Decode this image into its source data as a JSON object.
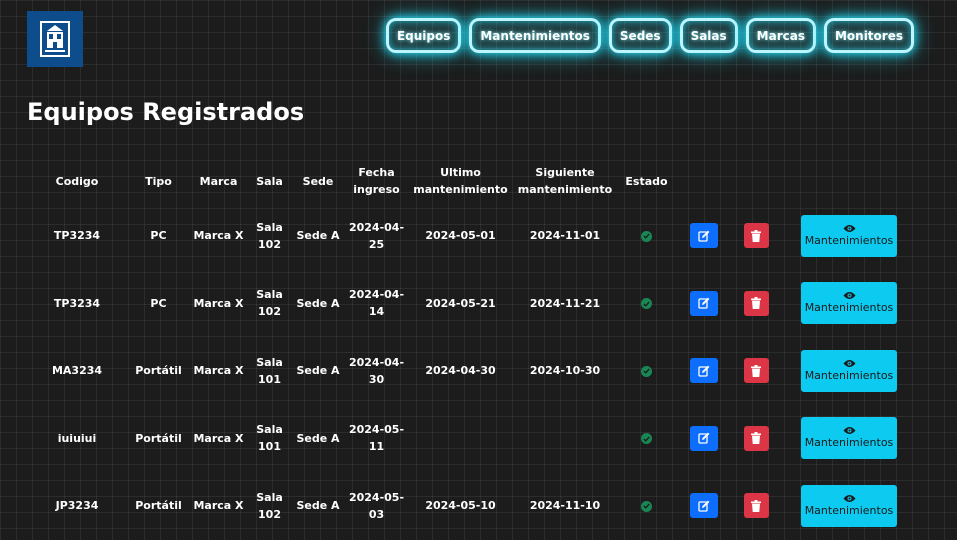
{
  "page": {
    "title": "Equipos Registrados"
  },
  "logo": {
    "icon": "building-icon",
    "color": "#0e4d8c"
  },
  "nav": {
    "items": [
      {
        "label": "Equipos"
      },
      {
        "label": "Mantenimientos"
      },
      {
        "label": "Sedes"
      },
      {
        "label": "Salas"
      },
      {
        "label": "Marcas"
      },
      {
        "label": "Monitores"
      }
    ]
  },
  "table": {
    "headers": {
      "codigo": "Codigo",
      "tipo": "Tipo",
      "marca": "Marca",
      "sala": "Sala",
      "sede": "Sede",
      "fecha": "Fecha ingreso",
      "ultimo": "Ultimo mantenimiento",
      "siguiente": "Siguiente mantenimiento",
      "estado": "Estado"
    },
    "rows": [
      {
        "codigo": "TP3234",
        "tipo": "PC",
        "marca": "Marca X",
        "sala": "Sala 102",
        "sede": "Sede A",
        "fecha": "2024-04-25",
        "ultimo": "2024-05-01",
        "siguiente": "2024-11-01",
        "mant_label": "Mantenimientos"
      },
      {
        "codigo": "TP3234",
        "tipo": "PC",
        "marca": "Marca X",
        "sala": "Sala 102",
        "sede": "Sede A",
        "fecha": "2024-04-14",
        "ultimo": "2024-05-21",
        "siguiente": "2024-11-21",
        "mant_label": "Mantenimientos"
      },
      {
        "codigo": "MA3234",
        "tipo": "Portátil",
        "marca": "Marca X",
        "sala": "Sala 101",
        "sede": "Sede A",
        "fecha": "2024-04-30",
        "ultimo": "2024-04-30",
        "siguiente": "2024-10-30",
        "mant_label": "Mantenimientos"
      },
      {
        "codigo": "iuiuiui",
        "tipo": "Portátil",
        "marca": "Marca X",
        "sala": "Sala 101",
        "sede": "Sede A",
        "fecha": "2024-05-11",
        "ultimo": "",
        "siguiente": "",
        "mant_label": "Mantenimientos"
      },
      {
        "codigo": "JP3234",
        "tipo": "Portátil",
        "marca": "Marca X",
        "sala": "Sala 102",
        "sede": "Sede A",
        "fecha": "2024-05-03",
        "ultimo": "2024-05-10",
        "siguiente": "2024-11-10",
        "mant_label": "Mantenimientos"
      }
    ]
  },
  "colors": {
    "edit": "#0d6efd",
    "delete": "#dc3545",
    "info": "#0dcaf0",
    "status_ok": "#198754",
    "neon": "#22e4ff"
  },
  "icons": {
    "status": "check-circle-icon",
    "edit": "edit-icon",
    "delete": "trash-icon",
    "view": "eye-icon"
  }
}
